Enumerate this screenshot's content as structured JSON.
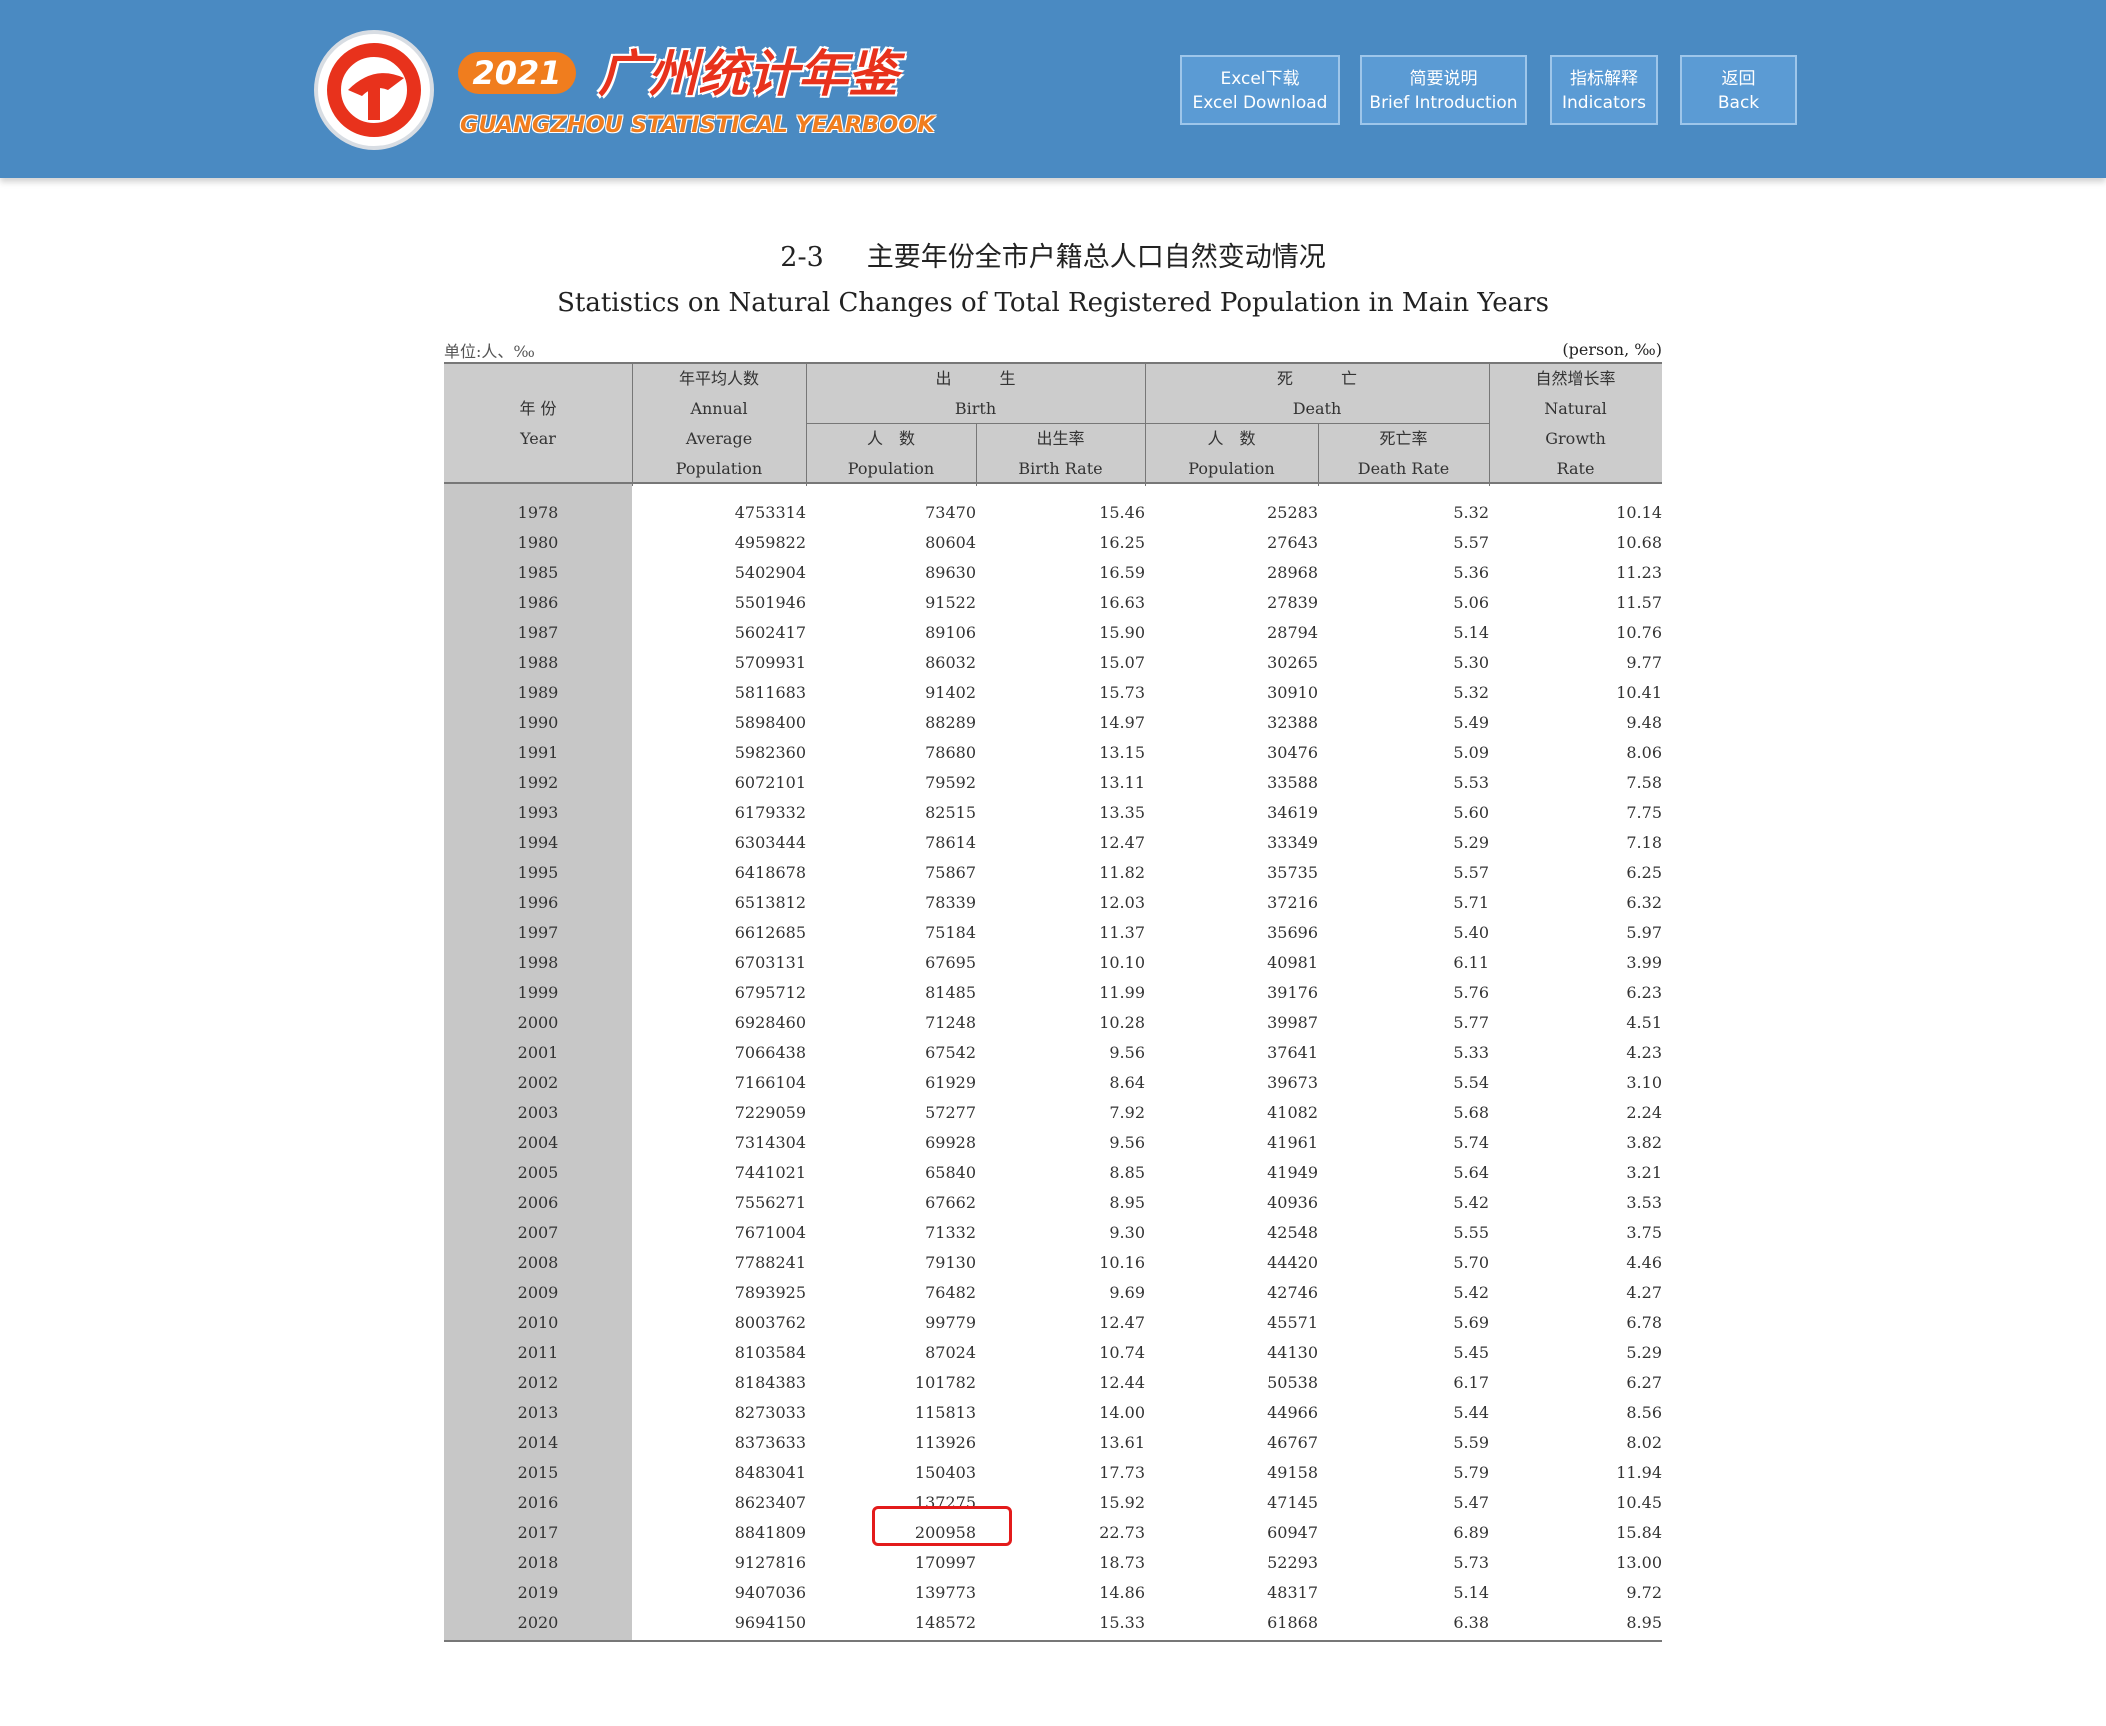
{
  "header": {
    "badge_year": "2021",
    "title_cn": "广州统计年鉴",
    "title_en": "GUANGZHOU STATISTICAL YEARBOOK",
    "brand_color": "#4a8ac2",
    "accent_color": "#f07d1e",
    "logo_icon": "guangzhou-statistics-logo-icon",
    "nav": [
      {
        "cn": "Excel下载",
        "en": "Excel Download"
      },
      {
        "cn": "简要说明",
        "en": "Brief Introduction"
      },
      {
        "cn": "指标解释",
        "en": "Indicators"
      },
      {
        "cn": "返回",
        "en": "Back"
      }
    ]
  },
  "table_title": {
    "number": "2-3",
    "cn": "主要年份全市户籍总人口自然变动情况",
    "en": "Statistics on Natural Changes of Total Registered Population in Main Years"
  },
  "unit": {
    "cn": "单位:人、‰",
    "en": "(person, ‰)"
  },
  "columns": {
    "year_cn": "年 份",
    "year_en": "Year",
    "avg_cn": "年平均人数",
    "avg_en1": "Annual",
    "avg_en2": "Average",
    "avg_en3": "Population",
    "birth_cn": "出　　　生",
    "birth_en": "Birth",
    "death_cn": "死　　　亡",
    "death_en": "Death",
    "pop_cn": "人　数",
    "pop_en": "Population",
    "brate_cn": "出生率",
    "brate_en": "Birth Rate",
    "drate_cn": "死亡率",
    "drate_en": "Death Rate",
    "grow_cn": "自然增长率",
    "grow_en1": "Natural",
    "grow_en2": "Growth",
    "grow_en3": "Rate"
  },
  "highlight_color": "#e31b1b",
  "rows": [
    [
      "1978",
      "4753314",
      "73470",
      "15.46",
      "25283",
      "5.32",
      "10.14"
    ],
    [
      "1980",
      "4959822",
      "80604",
      "16.25",
      "27643",
      "5.57",
      "10.68"
    ],
    [
      "1985",
      "5402904",
      "89630",
      "16.59",
      "28968",
      "5.36",
      "11.23"
    ],
    [
      "1986",
      "5501946",
      "91522",
      "16.63",
      "27839",
      "5.06",
      "11.57"
    ],
    [
      "1987",
      "5602417",
      "89106",
      "15.90",
      "28794",
      "5.14",
      "10.76"
    ],
    [
      "1988",
      "5709931",
      "86032",
      "15.07",
      "30265",
      "5.30",
      "9.77"
    ],
    [
      "1989",
      "5811683",
      "91402",
      "15.73",
      "30910",
      "5.32",
      "10.41"
    ],
    [
      "1990",
      "5898400",
      "88289",
      "14.97",
      "32388",
      "5.49",
      "9.48"
    ],
    [
      "1991",
      "5982360",
      "78680",
      "13.15",
      "30476",
      "5.09",
      "8.06"
    ],
    [
      "1992",
      "6072101",
      "79592",
      "13.11",
      "33588",
      "5.53",
      "7.58"
    ],
    [
      "1993",
      "6179332",
      "82515",
      "13.35",
      "34619",
      "5.60",
      "7.75"
    ],
    [
      "1994",
      "6303444",
      "78614",
      "12.47",
      "33349",
      "5.29",
      "7.18"
    ],
    [
      "1995",
      "6418678",
      "75867",
      "11.82",
      "35735",
      "5.57",
      "6.25"
    ],
    [
      "1996",
      "6513812",
      "78339",
      "12.03",
      "37216",
      "5.71",
      "6.32"
    ],
    [
      "1997",
      "6612685",
      "75184",
      "11.37",
      "35696",
      "5.40",
      "5.97"
    ],
    [
      "1998",
      "6703131",
      "67695",
      "10.10",
      "40981",
      "6.11",
      "3.99"
    ],
    [
      "1999",
      "6795712",
      "81485",
      "11.99",
      "39176",
      "5.76",
      "6.23"
    ],
    [
      "2000",
      "6928460",
      "71248",
      "10.28",
      "39987",
      "5.77",
      "4.51"
    ],
    [
      "2001",
      "7066438",
      "67542",
      "9.56",
      "37641",
      "5.33",
      "4.23"
    ],
    [
      "2002",
      "7166104",
      "61929",
      "8.64",
      "39673",
      "5.54",
      "3.10"
    ],
    [
      "2003",
      "7229059",
      "57277",
      "7.92",
      "41082",
      "5.68",
      "2.24"
    ],
    [
      "2004",
      "7314304",
      "69928",
      "9.56",
      "41961",
      "5.74",
      "3.82"
    ],
    [
      "2005",
      "7441021",
      "65840",
      "8.85",
      "41949",
      "5.64",
      "3.21"
    ],
    [
      "2006",
      "7556271",
      "67662",
      "8.95",
      "40936",
      "5.42",
      "3.53"
    ],
    [
      "2007",
      "7671004",
      "71332",
      "9.30",
      "42548",
      "5.55",
      "3.75"
    ],
    [
      "2008",
      "7788241",
      "79130",
      "10.16",
      "44420",
      "5.70",
      "4.46"
    ],
    [
      "2009",
      "7893925",
      "76482",
      "9.69",
      "42746",
      "5.42",
      "4.27"
    ],
    [
      "2010",
      "8003762",
      "99779",
      "12.47",
      "45571",
      "5.69",
      "6.78"
    ],
    [
      "2011",
      "8103584",
      "87024",
      "10.74",
      "44130",
      "5.45",
      "5.29"
    ],
    [
      "2012",
      "8184383",
      "101782",
      "12.44",
      "50538",
      "6.17",
      "6.27"
    ],
    [
      "2013",
      "8273033",
      "115813",
      "14.00",
      "44966",
      "5.44",
      "8.56"
    ],
    [
      "2014",
      "8373633",
      "113926",
      "13.61",
      "46767",
      "5.59",
      "8.02"
    ],
    [
      "2015",
      "8483041",
      "150403",
      "17.73",
      "49158",
      "5.79",
      "11.94"
    ],
    [
      "2016",
      "8623407",
      "137275",
      "15.92",
      "47145",
      "5.47",
      "10.45"
    ],
    [
      "2017",
      "8841809",
      "200958",
      "22.73",
      "60947",
      "6.89",
      "15.84"
    ],
    [
      "2018",
      "9127816",
      "170997",
      "18.73",
      "52293",
      "5.73",
      "13.00"
    ],
    [
      "2019",
      "9407036",
      "139773",
      "14.86",
      "48317",
      "5.14",
      "9.72"
    ],
    [
      "2020",
      "9694150",
      "148572",
      "15.33",
      "61868",
      "6.38",
      "8.95"
    ]
  ]
}
